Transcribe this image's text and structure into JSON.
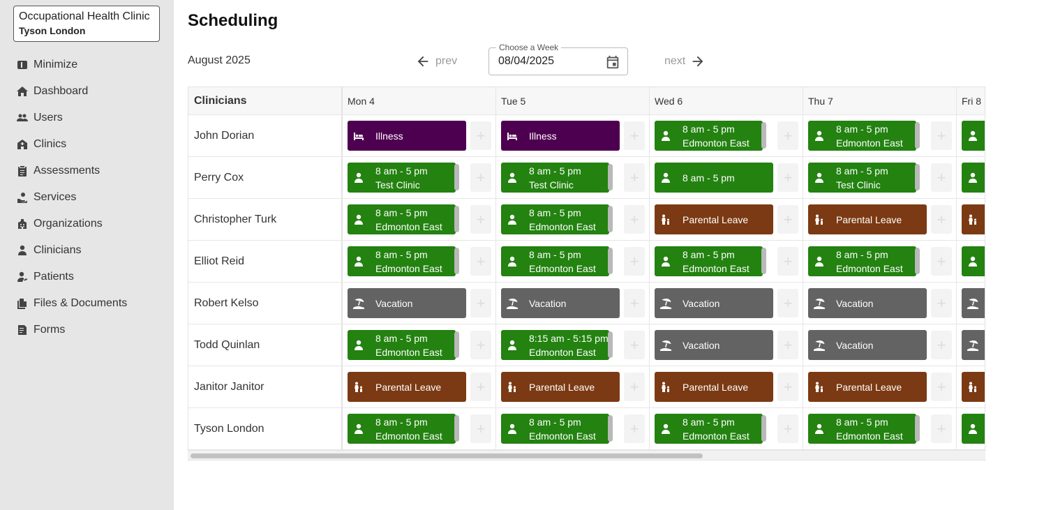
{
  "sidebar": {
    "org_name": "Occupational Health Clinic",
    "user_name": "Tyson London",
    "items": [
      {
        "label": "Minimize",
        "icon": "minimize-icon"
      },
      {
        "label": "Dashboard",
        "icon": "home-icon"
      },
      {
        "label": "Users",
        "icon": "users-icon"
      },
      {
        "label": "Clinics",
        "icon": "clinic-icon"
      },
      {
        "label": "Assessments",
        "icon": "clipboard-icon"
      },
      {
        "label": "Services",
        "icon": "hand-holding-icon"
      },
      {
        "label": "Organizations",
        "icon": "building-icon"
      },
      {
        "label": "Clinicians",
        "icon": "clinician-icon"
      },
      {
        "label": "Patients",
        "icon": "patient-icon"
      },
      {
        "label": "Files & Documents",
        "icon": "files-icon"
      },
      {
        "label": "Forms",
        "icon": "form-icon"
      }
    ]
  },
  "header": {
    "title": "Scheduling",
    "month": "August 2025",
    "prev_label": "prev",
    "next_label": "next",
    "week_legend": "Choose a Week",
    "week_value": "08/04/2025"
  },
  "grid": {
    "first_col_header": "Clinicians",
    "days": [
      "Mon 4",
      "Tue 5",
      "Wed 6",
      "Thu 7",
      "Fri 8"
    ],
    "colors": {
      "shift": "#238210",
      "illness": "#4e0050",
      "parental": "#7b3a13",
      "vacation": "#636363"
    },
    "rows": [
      {
        "name": "John Dorian",
        "cells": [
          {
            "kind": "illness",
            "lines": [
              "Illness"
            ]
          },
          {
            "kind": "illness",
            "lines": [
              "Illness"
            ]
          },
          {
            "kind": "shift",
            "lines": [
              "8 am - 5 pm",
              "Edmonton East"
            ],
            "scroll": true
          },
          {
            "kind": "shift",
            "lines": [
              "8 am - 5 pm",
              "Edmonton East"
            ],
            "scroll": true
          },
          {
            "kind": "shift",
            "lines": [
              ""
            ]
          }
        ]
      },
      {
        "name": "Perry Cox",
        "cells": [
          {
            "kind": "shift",
            "lines": [
              "8 am - 5 pm",
              "Test Clinic"
            ],
            "scroll": true
          },
          {
            "kind": "shift",
            "lines": [
              "8 am - 5 pm",
              "Test Clinic"
            ],
            "scroll": true
          },
          {
            "kind": "shift",
            "lines": [
              "8 am - 5 pm"
            ]
          },
          {
            "kind": "shift",
            "lines": [
              "8 am - 5 pm",
              "Test Clinic"
            ],
            "scroll": true
          },
          {
            "kind": "shift",
            "lines": [
              ""
            ]
          }
        ]
      },
      {
        "name": "Christopher Turk",
        "cells": [
          {
            "kind": "shift",
            "lines": [
              "8 am - 5 pm",
              "Edmonton East"
            ],
            "scroll": true
          },
          {
            "kind": "shift",
            "lines": [
              "8 am - 5 pm",
              "Edmonton East"
            ],
            "scroll": true
          },
          {
            "kind": "parental",
            "lines": [
              "Parental Leave"
            ]
          },
          {
            "kind": "parental",
            "lines": [
              "Parental Leave"
            ]
          },
          {
            "kind": "parental",
            "lines": [
              ""
            ]
          }
        ]
      },
      {
        "name": "Elliot Reid",
        "cells": [
          {
            "kind": "shift",
            "lines": [
              "8 am - 5 pm",
              "Edmonton East"
            ],
            "scroll": true
          },
          {
            "kind": "shift",
            "lines": [
              "8 am - 5 pm",
              "Edmonton East"
            ],
            "scroll": true
          },
          {
            "kind": "shift",
            "lines": [
              "8 am - 5 pm",
              "Edmonton East"
            ],
            "scroll": true
          },
          {
            "kind": "shift",
            "lines": [
              "8 am - 5 pm",
              "Edmonton East"
            ],
            "scroll": true
          },
          {
            "kind": "shift",
            "lines": [
              ""
            ]
          }
        ]
      },
      {
        "name": "Robert Kelso",
        "cells": [
          {
            "kind": "vacation",
            "lines": [
              "Vacation"
            ]
          },
          {
            "kind": "vacation",
            "lines": [
              "Vacation"
            ]
          },
          {
            "kind": "vacation",
            "lines": [
              "Vacation"
            ]
          },
          {
            "kind": "vacation",
            "lines": [
              "Vacation"
            ]
          },
          {
            "kind": "vacation",
            "lines": [
              ""
            ]
          }
        ]
      },
      {
        "name": "Todd Quinlan",
        "cells": [
          {
            "kind": "shift",
            "lines": [
              "8 am - 5 pm",
              "Edmonton East"
            ],
            "scroll": true
          },
          {
            "kind": "shift",
            "lines": [
              "8:15 am - 5:15 pm",
              "Edmonton East"
            ],
            "scroll": true
          },
          {
            "kind": "vacation",
            "lines": [
              "Vacation"
            ]
          },
          {
            "kind": "vacation",
            "lines": [
              "Vacation"
            ]
          },
          {
            "kind": "vacation",
            "lines": [
              ""
            ]
          }
        ]
      },
      {
        "name": "Janitor Janitor",
        "cells": [
          {
            "kind": "parental",
            "lines": [
              "Parental Leave"
            ]
          },
          {
            "kind": "parental",
            "lines": [
              "Parental Leave"
            ]
          },
          {
            "kind": "parental",
            "lines": [
              "Parental Leave"
            ]
          },
          {
            "kind": "parental",
            "lines": [
              "Parental Leave"
            ]
          },
          {
            "kind": "parental",
            "lines": [
              ""
            ]
          }
        ]
      },
      {
        "name": "Tyson London",
        "cells": [
          {
            "kind": "shift",
            "lines": [
              "8 am - 5 pm",
              "Edmonton East"
            ],
            "scroll": true
          },
          {
            "kind": "shift",
            "lines": [
              "8 am - 5 pm",
              "Edmonton East"
            ],
            "scroll": true
          },
          {
            "kind": "shift",
            "lines": [
              "8 am - 5 pm",
              "Edmonton East"
            ],
            "scroll": true
          },
          {
            "kind": "shift",
            "lines": [
              "8 am - 5 pm",
              "Edmonton East"
            ],
            "scroll": true
          },
          {
            "kind": "shift",
            "lines": [
              ""
            ]
          }
        ]
      }
    ]
  }
}
